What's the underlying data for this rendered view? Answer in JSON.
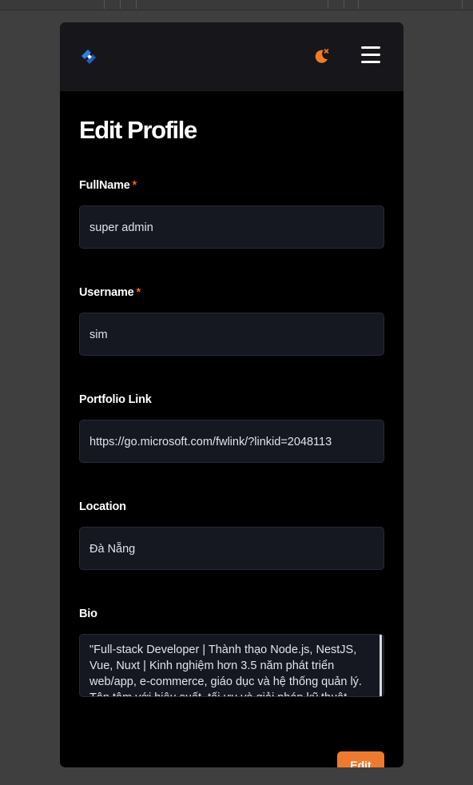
{
  "header": {
    "logo_icon": "brand-logo-icon",
    "theme_icon": "moon-icon",
    "menu_icon": "hamburger-menu-icon",
    "brand_color": "#2b7fe8",
    "accent_color": "#f47b20"
  },
  "page": {
    "title": "Edit Profile"
  },
  "form": {
    "fullname": {
      "label": "FullName",
      "required_mark": "*",
      "value": "super admin"
    },
    "username": {
      "label": "Username",
      "required_mark": "*",
      "value": "sim"
    },
    "portfolio": {
      "label": "Portfolio Link",
      "value": "https://go.microsoft.com/fwlink/?linkid=2048113"
    },
    "location": {
      "label": "Location",
      "value": "Đà Nẵng"
    },
    "bio": {
      "label": "Bio",
      "value": "\"Full-stack Developer | Thành thạo Node.js, NestJS, Vue, Nuxt | Kinh nghiệm hơn 3.5 năm phát triển web/app, e-commerce, giáo dục và hệ thống quản lý. Tận tâm với hiệu suất, tối ưu và giải pháp kỹ thuật"
    },
    "submit_label": "Edit"
  }
}
